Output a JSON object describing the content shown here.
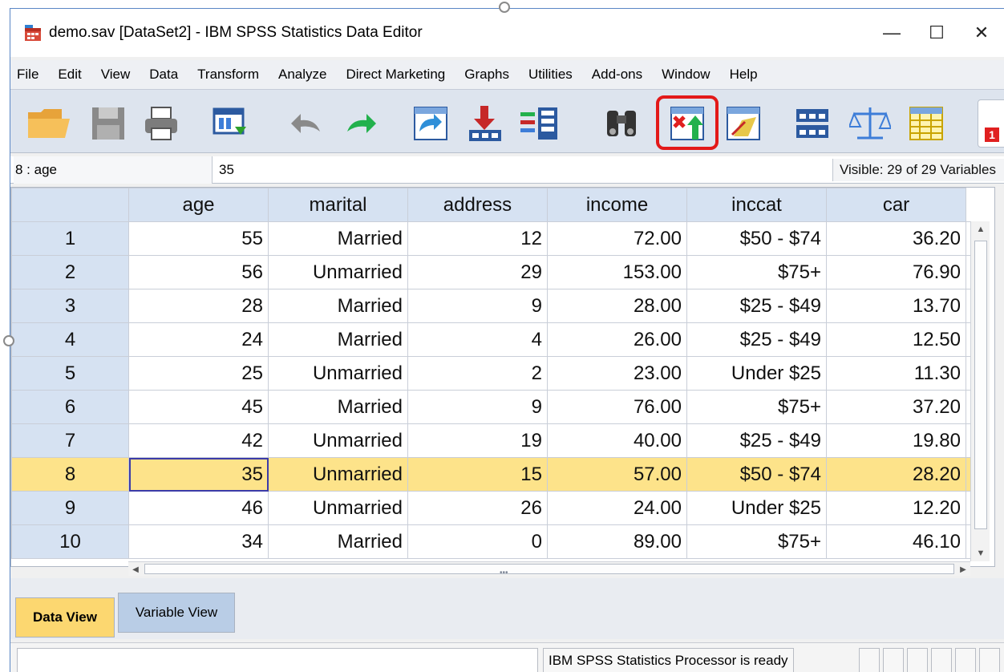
{
  "window": {
    "title": "demo.sav [DataSet2] - IBM SPSS Statistics Data Editor",
    "minimize": "—",
    "maximize": "☐",
    "close": "✕"
  },
  "menu": [
    "File",
    "Edit",
    "View",
    "Data",
    "Transform",
    "Analyze",
    "Direct Marketing",
    "Graphs",
    "Utilities",
    "Add-ons",
    "Window",
    "Help"
  ],
  "toolbar": {
    "icons": [
      "open-folder-icon",
      "save-icon",
      "print-icon",
      "dialog-recall-icon",
      "undo-icon",
      "redo-icon",
      "go-to-case-icon",
      "go-to-variable-icon",
      "variables-icon",
      "find-icon",
      "insert-cases-icon",
      "insert-variable-icon",
      "split-file-icon",
      "weight-cases-icon",
      "select-cases-icon"
    ],
    "highlighted": "insert-cases-icon",
    "value_labels_badge": "1"
  },
  "cell_editor": {
    "ref": "8 : age",
    "value": "35",
    "visible": "Visible: 29 of 29 Variables"
  },
  "grid": {
    "columns": [
      "age",
      "marital",
      "address",
      "income",
      "inccat",
      "car"
    ],
    "rows": [
      {
        "n": "1",
        "cells": [
          "55",
          "Married",
          "12",
          "72.00",
          "$50 - $74",
          "36.20"
        ]
      },
      {
        "n": "2",
        "cells": [
          "56",
          "Unmarried",
          "29",
          "153.00",
          "$75+",
          "76.90"
        ]
      },
      {
        "n": "3",
        "cells": [
          "28",
          "Married",
          "9",
          "28.00",
          "$25 - $49",
          "13.70"
        ]
      },
      {
        "n": "4",
        "cells": [
          "24",
          "Married",
          "4",
          "26.00",
          "$25 - $49",
          "12.50"
        ]
      },
      {
        "n": "5",
        "cells": [
          "25",
          "Unmarried",
          "2",
          "23.00",
          "Under $25",
          "11.30"
        ]
      },
      {
        "n": "6",
        "cells": [
          "45",
          "Married",
          "9",
          "76.00",
          "$75+",
          "37.20"
        ]
      },
      {
        "n": "7",
        "cells": [
          "42",
          "Unmarried",
          "19",
          "40.00",
          "$25 - $49",
          "19.80"
        ]
      },
      {
        "n": "8",
        "cells": [
          "35",
          "Unmarried",
          "15",
          "57.00",
          "$50 - $74",
          "28.20"
        ]
      },
      {
        "n": "9",
        "cells": [
          "46",
          "Unmarried",
          "26",
          "24.00",
          "Under $25",
          "12.20"
        ]
      },
      {
        "n": "10",
        "cells": [
          "34",
          "Married",
          "0",
          "89.00",
          "$75+",
          "46.10"
        ]
      }
    ],
    "selected_row": "8"
  },
  "tabs": {
    "data_view": "Data View",
    "variable_view": "Variable View"
  },
  "status": {
    "processor": "IBM SPSS Statistics Processor is ready"
  }
}
